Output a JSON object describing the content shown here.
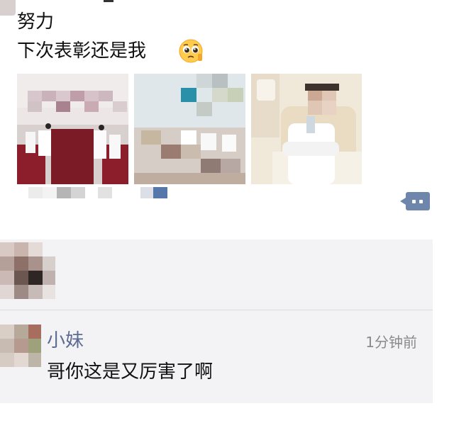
{
  "post": {
    "line1": "努力",
    "line2": "下次表彰还是我",
    "emoji": "smiling-face-with-pleading-eyes",
    "photos": [
      {
        "name": "meeting-room-photo",
        "colors": {
          "wall": "#e9e4e4",
          "table": "#7a1b25",
          "people": "#ffffff"
        }
      },
      {
        "name": "office-group-photo",
        "colors": {
          "wall": "#e8eef0",
          "accent": "#2a8fa8"
        }
      },
      {
        "name": "doctor-portrait-photo",
        "colors": {
          "background": "#efe7d6",
          "coat": "#ffffff"
        }
      }
    ]
  },
  "comment_action": {
    "icon": "comment-icon",
    "color": "#6f86ac"
  },
  "comment": {
    "name": "小妹",
    "time": "1分钟前",
    "text": "哥你这是又厉害了啊"
  },
  "colors": {
    "name_link": "#5b6b95",
    "panel_bg": "#f3f3f5",
    "time": "#8a8a8a"
  }
}
